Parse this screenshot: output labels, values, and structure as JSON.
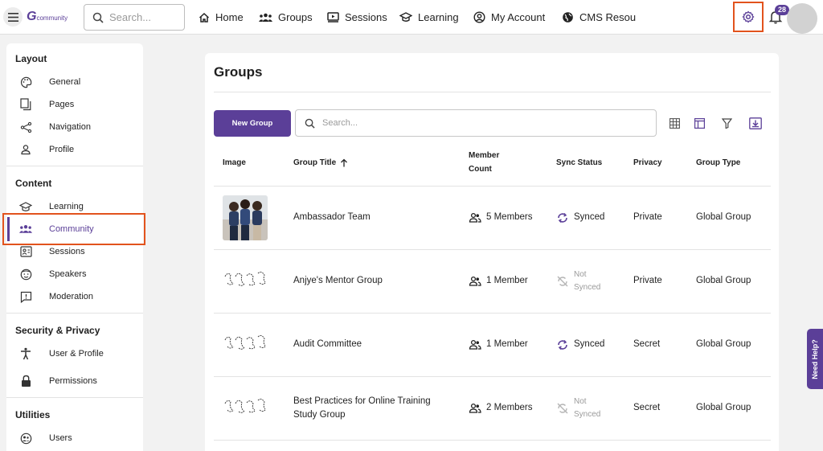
{
  "topbar": {
    "logo_mark": "G",
    "logo_text": "community",
    "search_placeholder": "Search...",
    "nav": [
      {
        "label": "Home",
        "icon": "home-icon"
      },
      {
        "label": "Groups",
        "icon": "groups-icon"
      },
      {
        "label": "Sessions",
        "icon": "sessions-icon"
      },
      {
        "label": "Learning",
        "icon": "learning-icon"
      },
      {
        "label": "My Account",
        "icon": "account-icon"
      },
      {
        "label": "CMS Resourc",
        "icon": "cms-resources-icon"
      }
    ],
    "notification_count": "28",
    "settings_icon": "gear-icon"
  },
  "sidebar": {
    "sections": [
      {
        "title": "Layout",
        "items": [
          {
            "label": "General",
            "icon": "palette-icon"
          },
          {
            "label": "Pages",
            "icon": "pages-icon"
          },
          {
            "label": "Navigation",
            "icon": "share-icon"
          },
          {
            "label": "Profile",
            "icon": "person-icon"
          }
        ]
      },
      {
        "title": "Content",
        "items": [
          {
            "label": "Learning",
            "icon": "learning-icon"
          },
          {
            "label": "Community",
            "icon": "community-icon",
            "active": true
          },
          {
            "label": "Sessions",
            "icon": "contact-card-icon"
          },
          {
            "label": "Speakers",
            "icon": "speaker-face-icon"
          },
          {
            "label": "Moderation",
            "icon": "moderation-icon"
          }
        ]
      },
      {
        "title": "Security & Privacy",
        "items": [
          {
            "label": "User & Profile",
            "icon": "accessibility-icon"
          },
          {
            "label": "Permissions",
            "icon": "lock-icon"
          }
        ]
      },
      {
        "title": "Utilities",
        "items": [
          {
            "label": "Users",
            "icon": "users-icon"
          }
        ]
      }
    ]
  },
  "main": {
    "title": "Groups",
    "new_button": "New Group",
    "search_placeholder": "Search...",
    "toolbar_icons": [
      "grid-view-icon",
      "table-view-icon",
      "filter-icon",
      "download-icon"
    ],
    "columns": {
      "image": "Image",
      "title": "Group Title",
      "member_count_line1": "Member",
      "member_count_line2": "Count",
      "sync": "Sync Status",
      "privacy": "Privacy",
      "type": "Group Type"
    },
    "rows": [
      {
        "title_line1": "Ambassador Team",
        "title_line2": "",
        "members": "5 Members",
        "sync_line1": "Synced",
        "sync_line2": "",
        "synced": true,
        "privacy": "Private",
        "type": "Global Group",
        "image": "photo"
      },
      {
        "title_line1": "Anjye's Mentor Group",
        "title_line2": "",
        "members": "1 Member",
        "sync_line1": "Not",
        "sync_line2": "Synced",
        "synced": false,
        "privacy": "Private",
        "type": "Global Group",
        "image": "sketch"
      },
      {
        "title_line1": "Audit Committee",
        "title_line2": "",
        "members": "1 Member",
        "sync_line1": "Synced",
        "sync_line2": "",
        "synced": true,
        "privacy": "Secret",
        "type": "Global Group",
        "image": "sketch"
      },
      {
        "title_line1": "Best Practices for Online Training",
        "title_line2": "Study Group",
        "members": "2 Members",
        "sync_line1": "Not",
        "sync_line2": "Synced",
        "synced": false,
        "privacy": "Secret",
        "type": "Global Group",
        "image": "sketch"
      }
    ]
  },
  "help_tab": "Need Help?",
  "colors": {
    "accent": "#5b3f98",
    "highlight": "#e2531d"
  }
}
